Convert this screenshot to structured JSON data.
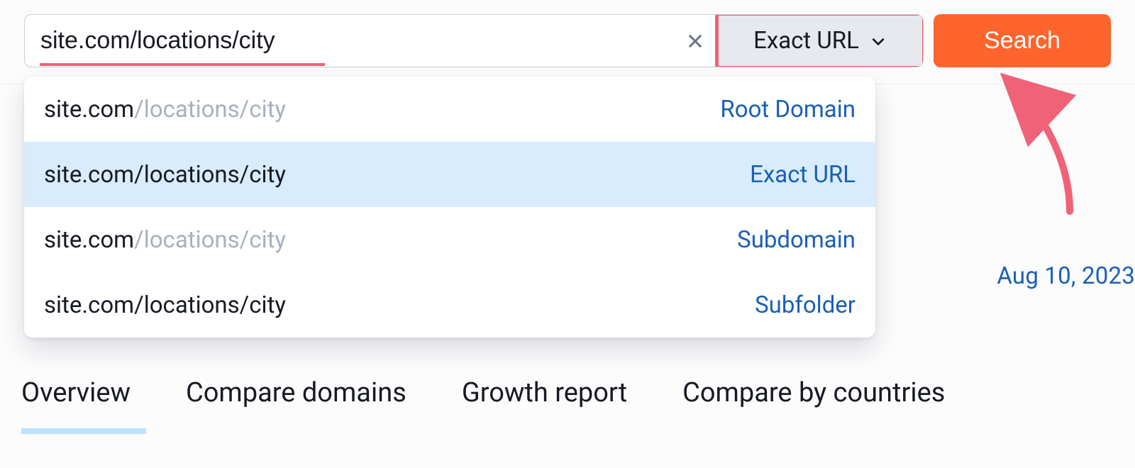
{
  "search": {
    "value": "site.com/locations/city",
    "clear_icon": "close-icon",
    "scope_label": "Exact URL",
    "button_label": "Search"
  },
  "suggestions": [
    {
      "url_prefix": "site.com",
      "url_suffix": "/locations/city",
      "scope": "Root Domain",
      "selected": false,
      "dim_suffix": true
    },
    {
      "url_prefix": "site.com/locations/city",
      "url_suffix": "",
      "scope": "Exact URL",
      "selected": true,
      "dim_suffix": false
    },
    {
      "url_prefix": "site.com",
      "url_suffix": "/locations/city",
      "scope": "Subdomain",
      "selected": false,
      "dim_suffix": true
    },
    {
      "url_prefix": "site.com/locations/city",
      "url_suffix": "",
      "scope": "Subfolder",
      "selected": false,
      "dim_suffix": false
    }
  ],
  "date_label": "Aug 10, 2023",
  "tabs": [
    {
      "label": "Overview",
      "active": true
    },
    {
      "label": "Compare domains",
      "active": false
    },
    {
      "label": "Growth report",
      "active": false
    },
    {
      "label": "Compare by countries",
      "active": false
    }
  ],
  "annotation": {
    "color": "#f06277"
  }
}
